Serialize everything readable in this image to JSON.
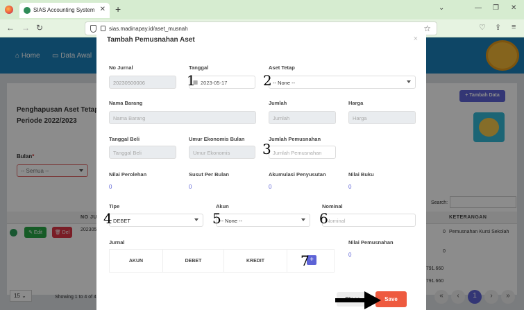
{
  "browser": {
    "tab_title": "SIAS Accounting System",
    "url": "sias.madinapay.id/aset_musnah"
  },
  "header": {
    "nav": [
      "Home",
      "Data Awal"
    ]
  },
  "page": {
    "title_line1": "Penghapusan Aset Tetap",
    "title_line2": "Periode 2022/2023",
    "bulan_label": "Bulan",
    "bulan_value": "-- Semua --",
    "tambah_label": "+ Tambah Data",
    "search_label": "Search:",
    "table": {
      "col_no_jurnal": "NO JUR",
      "col_keterangan": "KETERANGAN",
      "row_no_jurnal": "2023050",
      "row_amount_1": "0",
      "row_amount_2": "0",
      "row_keterangan": "Pemusnahan Kursi Sekolah",
      "total_1": "5.791.660",
      "total_2": "5.791.660",
      "edit_label": "Edit",
      "del_label": "Del"
    },
    "page_size": "15",
    "showing": "Showing 1 to 4 of 4",
    "current_page": "1"
  },
  "modal": {
    "title": "Tambah Pemusnahan Aset",
    "fields": {
      "no_jurnal": {
        "label": "No Jurnal",
        "value": "20230500006"
      },
      "tanggal": {
        "label": "Tanggal",
        "value": "2023-05-17"
      },
      "aset_tetap": {
        "label": "Aset Tetap",
        "value": "-- None --"
      },
      "nama_barang": {
        "label": "Nama Barang",
        "placeholder": "Nama Barang"
      },
      "jumlah": {
        "label": "Jumlah",
        "placeholder": "Jumlah"
      },
      "harga": {
        "label": "Harga",
        "placeholder": "Harga"
      },
      "tanggal_beli": {
        "label": "Tanggal Beli",
        "placeholder": "Tanggal Beli"
      },
      "umur_ekonomis": {
        "label": "Umur Ekonomis Bulan",
        "placeholder": "Umur Ekonomis"
      },
      "jumlah_pemusnahan": {
        "label": "Jumlah Pemusnahan",
        "placeholder": "Jumlah Pemusnahan"
      },
      "nilai_perolehan": {
        "label": "Nilai Perolehan",
        "value": "0"
      },
      "susut_per_bulan": {
        "label": "Susut Per Bulan",
        "value": "0"
      },
      "akumulasi_penyusutan": {
        "label": "Akumulasi Penyusutan",
        "value": "0"
      },
      "nilai_buku": {
        "label": "Nilai Buku",
        "value": "0"
      },
      "tipe": {
        "label": "Tipe",
        "value": "DEBET"
      },
      "akun": {
        "label": "Akun",
        "value": "-- None --"
      },
      "nominal": {
        "label": "Nominal",
        "placeholder": "Nominal"
      },
      "jurnal": {
        "label": "Jurnal"
      },
      "nilai_pemusnahan": {
        "label": "Nilai Pemusnahan",
        "value": "0"
      }
    },
    "jurnal_columns": [
      "AKUN",
      "DEBET",
      "KREDIT"
    ],
    "add_label": "+",
    "close_label": "Close",
    "save_label": "Save"
  },
  "annotations": [
    "1",
    "2",
    "3",
    "4",
    "5",
    "6",
    "7"
  ]
}
